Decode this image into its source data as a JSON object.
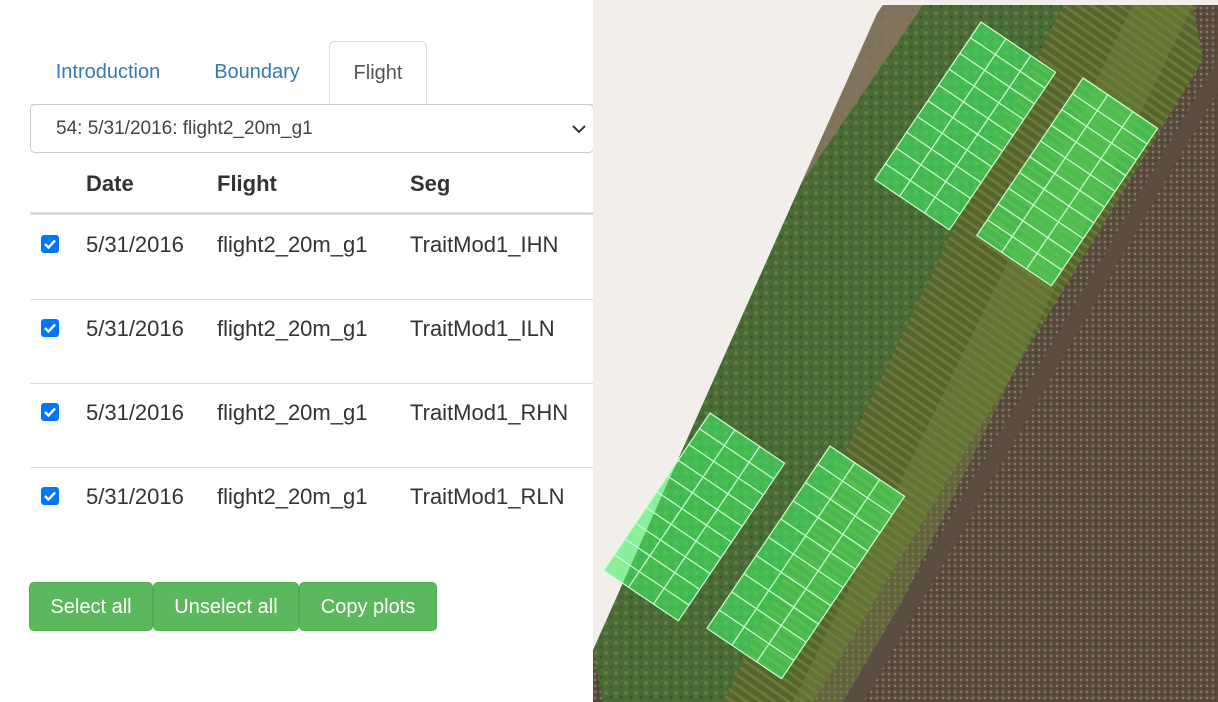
{
  "tabs": [
    {
      "label": "Introduction",
      "active": false
    },
    {
      "label": "Boundary",
      "active": false
    },
    {
      "label": "Flight",
      "active": true
    }
  ],
  "flight_select": {
    "value": "54: 5/31/2016: flight2_20m_g1"
  },
  "table": {
    "headers": [
      "",
      "Date",
      "Flight",
      "Seg"
    ],
    "rows": [
      {
        "checked": true,
        "date": "5/31/2016",
        "flight": "flight2_20m_g1",
        "seg": "TraitMod1_IHN"
      },
      {
        "checked": true,
        "date": "5/31/2016",
        "flight": "flight2_20m_g1",
        "seg": "TraitMod1_ILN"
      },
      {
        "checked": true,
        "date": "5/31/2016",
        "flight": "flight2_20m_g1",
        "seg": "TraitMod1_RHN"
      },
      {
        "checked": true,
        "date": "5/31/2016",
        "flight": "flight2_20m_g1",
        "seg": "TraitMod1_RLN"
      }
    ]
  },
  "buttons": {
    "select_all": "Select all",
    "unselect_all": "Unselect all",
    "copy_plots": "Copy plots"
  },
  "colors": {
    "link": "#337ab7",
    "button": "#5cb85c",
    "checkbox": "#0075ff",
    "plot_overlay": "#44ee66"
  }
}
